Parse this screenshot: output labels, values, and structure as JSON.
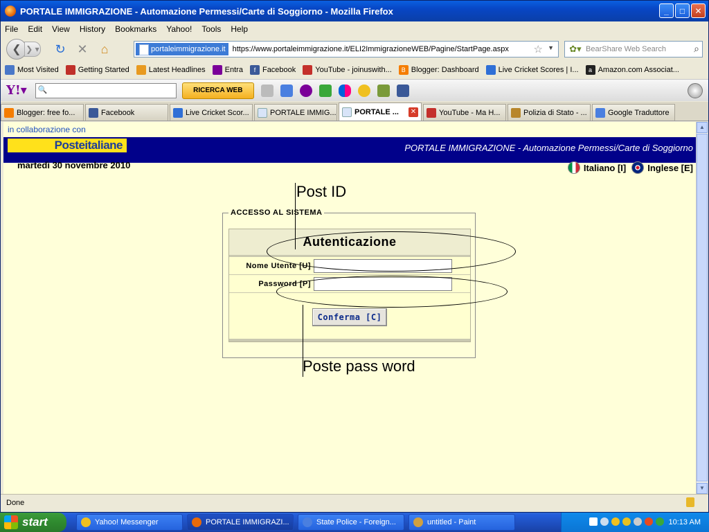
{
  "window": {
    "title": "PORTALE IMMIGRAZIONE - Automazione Permessi/Carte di Soggiorno - Mozilla Firefox"
  },
  "menu": [
    "File",
    "Edit",
    "View",
    "History",
    "Bookmarks",
    "Yahoo!",
    "Tools",
    "Help"
  ],
  "address": {
    "site": "portaleimmigrazione.it",
    "url": "https://www.portaleimmigrazione.it/ELI2ImmigrazioneWEB/Pagine/StartPage.aspx"
  },
  "search": {
    "placeholder": "BearShare Web Search"
  },
  "bookmarks": [
    {
      "label": "Most Visited",
      "color": "#4a78c8"
    },
    {
      "label": "Getting Started",
      "color": "#c0302a"
    },
    {
      "label": "Latest Headlines",
      "color": "#e89a20"
    },
    {
      "label": "Entra",
      "color": "#7b0099"
    },
    {
      "label": "Facebook",
      "color": "#3b5998"
    },
    {
      "label": "YouTube - joinuswith...",
      "color": "#c4302b"
    },
    {
      "label": "Blogger: Dashboard",
      "color": "#f57d00"
    },
    {
      "label": "Live Cricket Scores | I...",
      "color": "#2f6fd6"
    },
    {
      "label": "Amazon.com Associat...",
      "color": "#222222"
    }
  ],
  "yahoo": {
    "search_button": "RICERCA WEB"
  },
  "tabs": [
    {
      "label": "Blogger: free fo...",
      "color": "#f57d00"
    },
    {
      "label": "Facebook",
      "color": "#3b5998"
    },
    {
      "label": "Live Cricket Scor...",
      "color": "#2f6fd6"
    },
    {
      "label": "PORTALE IMMIG...",
      "color": "#d8e4f8"
    },
    {
      "label": "PORTALE ...",
      "color": "#d8e4f8"
    },
    {
      "label": "YouTube - Ma H...",
      "color": "#c4302b"
    },
    {
      "label": "Polizia di Stato - ...",
      "color": "#b8862a"
    },
    {
      "label": "Google Traduttore",
      "color": "#4a7fe0"
    }
  ],
  "page": {
    "collab": "in collaborazione con",
    "logo_text": "Posteitaliane",
    "banner_title": "PORTALE IMMIGRAZIONE - Automazione Permessi/Carte di Soggiorno",
    "date": "martedì 30 novembre 2010",
    "lang_it": "Italiano [I]",
    "lang_en": "Inglese [E]",
    "legend": "ACCESSO AL SISTEMA",
    "heading": "Autenticazione",
    "username_label": "Nome Utente [U]",
    "password_label": "Password [P]",
    "confirm_label": "Conferma [C]"
  },
  "annotations": {
    "post_id": "Post ID",
    "poste_password": "Poste pass word"
  },
  "status": {
    "text": "Done"
  },
  "taskbar": {
    "start": "start",
    "tasks": [
      {
        "label": "Yahoo! Messenger",
        "color": "#f0c020"
      },
      {
        "label": "PORTALE IMMIGRAZI...",
        "color": "#e86a0a"
      },
      {
        "label": "State Police - Foreign...",
        "color": "#4a7fe0"
      },
      {
        "label": "untitled - Paint",
        "color": "#d0a040"
      }
    ],
    "clock": "10:13 AM"
  }
}
